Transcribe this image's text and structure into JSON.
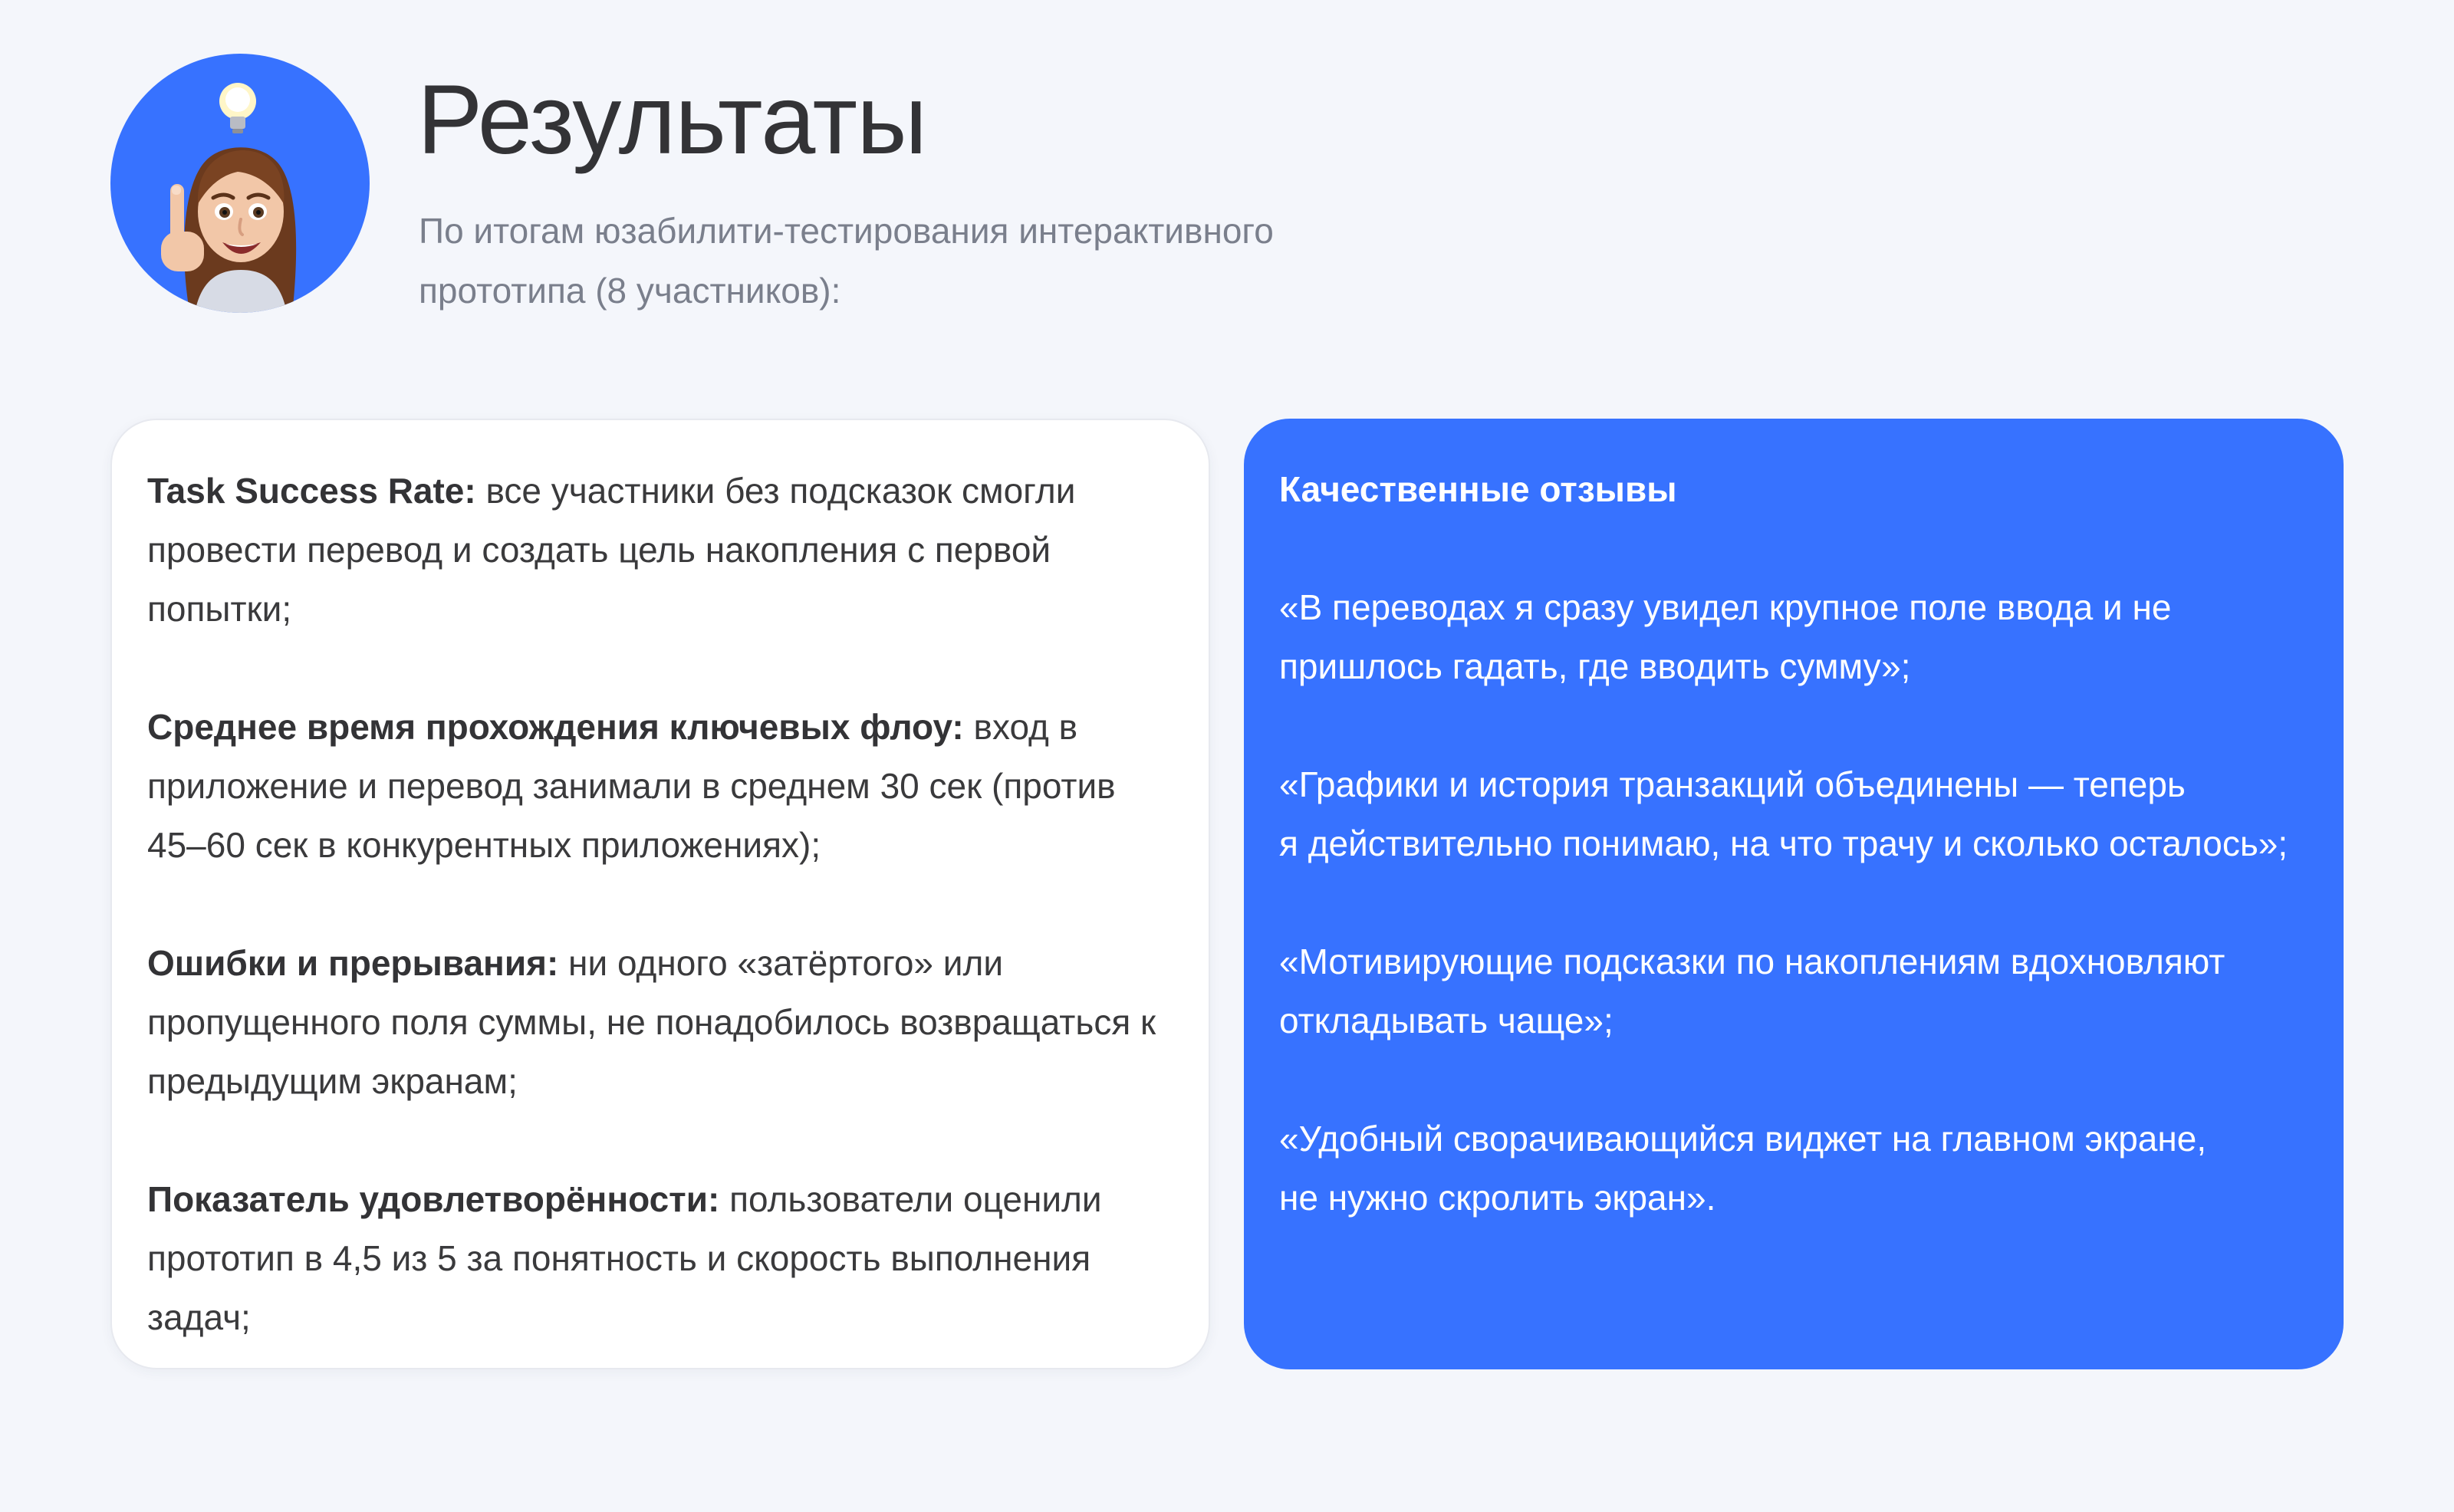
{
  "header": {
    "title": "Результаты",
    "subtitle": "По итогам юзабилити-тестирования интерактивного прототипа (8 участников):"
  },
  "avatar": {
    "icon": "memoji-avatar-icon",
    "bulb_icon": "lightbulb-icon",
    "bg_color": "#3772ff"
  },
  "metrics": [
    {
      "label": "Task Success Rate:",
      "text": " все участники без подсказок смогли провести перевод и создать цель накопления с первой попытки;"
    },
    {
      "label": "Среднее время прохождения ключевых флоу:",
      "text": " вход в приложение и перевод занимали в среднем 30 сек (против 45–60 сек в конкурентных приложениях);"
    },
    {
      "label": "Ошибки и прерывания:",
      "text": " ни одного «затёртого» или пропущенного поля суммы, не понадобилось возвращаться к предыдущим экранам;"
    },
    {
      "label": "Показатель удовлетворённости:",
      "text": " пользователи оценили прототип в 4,5 из 5 за понятность и скорость выполнения задач;"
    }
  ],
  "feedback": {
    "heading": "Качественные отзывы",
    "quotes": [
      {
        "lines": [
          "«В переводах я сразу увидел крупное поле ввода и не",
          "пришлось гадать, где вводить сумму»;"
        ]
      },
      {
        "lines": [
          "«Графики и история транзакций объединены — теперь",
          "я действительно понимаю, на что трачу и сколько осталось»;"
        ]
      },
      {
        "lines": [
          "«Мотивирующие подсказки по накоплениям вдохновляют",
          "откладывать чаще»;"
        ]
      },
      {
        "lines": [
          "«Удобный сворачивающийся виджет на главном экране,",
          "не нужно скролить экран»."
        ]
      }
    ]
  },
  "colors": {
    "accent": "#3772ff",
    "background": "#f4f6fb",
    "card": "#ffffff"
  }
}
